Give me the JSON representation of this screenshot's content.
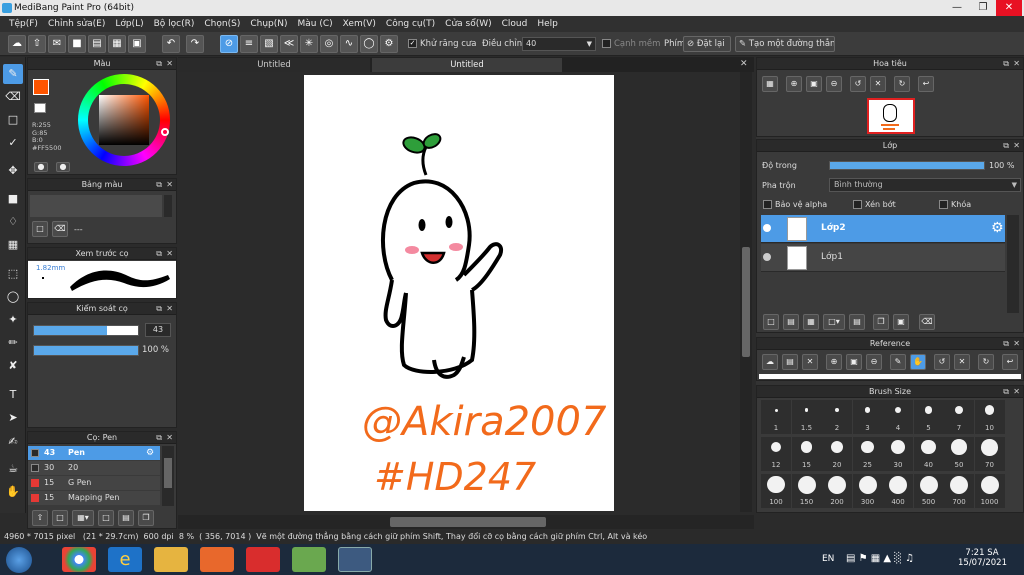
{
  "window": {
    "title": "MediBang Paint Pro (64bit)"
  },
  "menu": [
    "Tệp(F)",
    "Chỉnh sửa(E)",
    "Lớp(L)",
    "Bộ lọc(R)",
    "Chọn(S)",
    "Chụp(N)",
    "Màu (C)",
    "Xem(V)",
    "Công cụ(T)",
    "Cửa sổ(W)",
    "Cloud",
    "Help"
  ],
  "toolbar": {
    "antialias_label": "Khử răng cưa",
    "adjust_label": "Điều chỉnh",
    "adjust_value": "40",
    "edge_label": "Cạnh mềm",
    "key_label": "Phím",
    "reset_label": "Đặt lại",
    "line_label": "Tạo một đường thẳng"
  },
  "color_panel": {
    "title": "Màu",
    "r": "R:255",
    "g": "G:85",
    "b": "B:0",
    "hex": "#FF5500",
    "primary": "#FF5500"
  },
  "swatch_panel": {
    "title": "Bảng màu",
    "dash": "---"
  },
  "brush_preview": {
    "title": "Xem trước cọ",
    "size": "1.82mm"
  },
  "brush_control": {
    "title": "Kiểm soát cọ",
    "size": "43",
    "size_fraction": 0.7,
    "opacity": "100 %",
    "opacity_fraction": 1.0
  },
  "brush_list": {
    "title": "Cọ: Pen",
    "items": [
      {
        "size": "43",
        "name": "Pen",
        "color": "#4d9be6"
      },
      {
        "size": "30",
        "name": "20",
        "color": "#2a2a2a"
      },
      {
        "size": "15",
        "name": "G Pen",
        "color": "#e53935"
      },
      {
        "size": "15",
        "name": "Mapping Pen",
        "color": "#e53935"
      }
    ]
  },
  "document": {
    "tab1": "Untitled",
    "tab2": "Untitled"
  },
  "navigator": {
    "title": "Hoa tiêu"
  },
  "layer_panel": {
    "title": "Lớp",
    "opacity_label": "Độ trong",
    "opacity_value": "100 %",
    "opacity_fraction": 1.0,
    "blend_label": "Pha trộn",
    "blend_value": "Bình thường",
    "protect_alpha": "Bảo vệ alpha",
    "clipping": "Xén bớt",
    "lock": "Khóa",
    "layers": [
      {
        "name": "Lớp2",
        "active": true
      },
      {
        "name": "Lớp1",
        "active": false
      }
    ]
  },
  "reference": {
    "title": "Reference"
  },
  "brush_size": {
    "title": "Brush Size",
    "sizes": [
      "1",
      "1.5",
      "2",
      "3",
      "4",
      "5",
      "7",
      "10",
      "12",
      "15",
      "20",
      "25",
      "30",
      "40",
      "50",
      "70",
      "100",
      "150",
      "200",
      "300",
      "400",
      "500",
      "700",
      "1000"
    ]
  },
  "status": {
    "dims": "4960 * 7015 pixel",
    "size_cm": "(21 * 29.7cm)",
    "dpi": "600 dpi",
    "zoom": "8 %",
    "coords": "( 356, 7014 )",
    "hint": "Vẽ một đường thẳng bằng cách giữ phím Shift, Thay đổi cỡ cọ bằng cách giữ phím Ctrl, Alt và kéo"
  },
  "taskbar": {
    "lang": "EN",
    "time": "7:21 SA",
    "date": "15/07/2021"
  }
}
